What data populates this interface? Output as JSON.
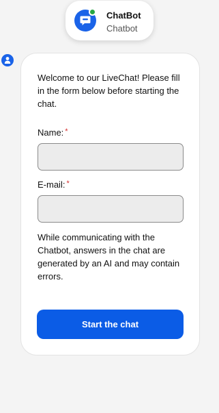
{
  "header": {
    "bot_name": "ChatBot",
    "bot_subtitle": "Chatbot",
    "avatar_icon": "chat-bubble-icon",
    "status": "online",
    "status_color": "#27a745"
  },
  "user": {
    "avatar_icon": "user-icon"
  },
  "form": {
    "intro": "Welcome to our LiveChat! Please fill in the form below before starting the chat.",
    "name_label": "Name:",
    "name_required_mark": "*",
    "name_value": "",
    "email_label": "E-mail:",
    "email_required_mark": "*",
    "email_value": "",
    "disclaimer": "While communicating with the Chatbot, answers in the chat are generated by an AI and may contain errors.",
    "submit_label": "Start the chat"
  },
  "colors": {
    "accent": "#0b5ce6",
    "required": "#d42d2d"
  }
}
